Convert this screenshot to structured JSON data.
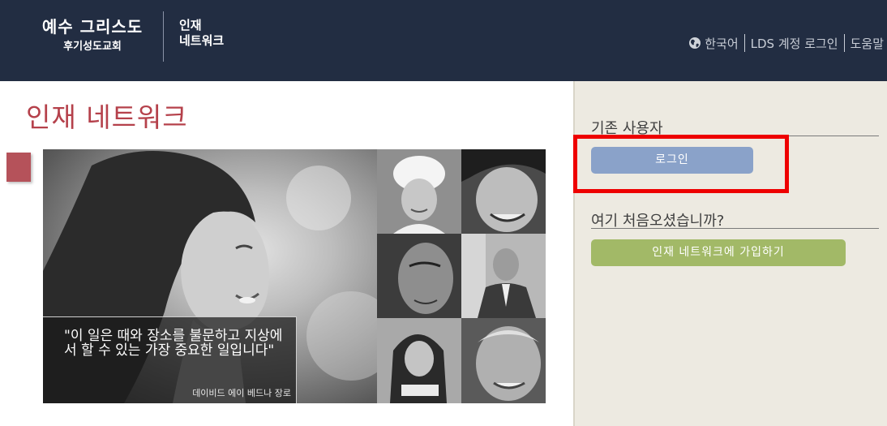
{
  "header": {
    "logo_main": "예수 그리스도",
    "logo_sub": "후기성도교회",
    "app_name_line1": "인재",
    "app_name_line2": "네트워크",
    "nav": {
      "language": "한국어",
      "login": "LDS 계정 로그인",
      "help": "도움말"
    }
  },
  "main": {
    "title": "인재 네트워크",
    "quote": {
      "text": "\"이 일은 때와 장소를 불문하고 지상에서 할 수 있는 가장 중요한 일입니다\"",
      "author": "데이비드 에이 베드나 장로"
    }
  },
  "side": {
    "existing_title": "기존 사용자",
    "login_button": "로그인",
    "new_title": "여기 처음오셨습니까?",
    "join_button": "인재 네트워크에 가입하기"
  },
  "colors": {
    "header_bg": "#222d42",
    "title_red": "#b5414b",
    "login_blue": "#8aa2c9",
    "join_green": "#a2b967",
    "highlight_red": "#ee0000",
    "side_bg": "#edeae1"
  },
  "icons": {
    "language": "globe-icon"
  }
}
